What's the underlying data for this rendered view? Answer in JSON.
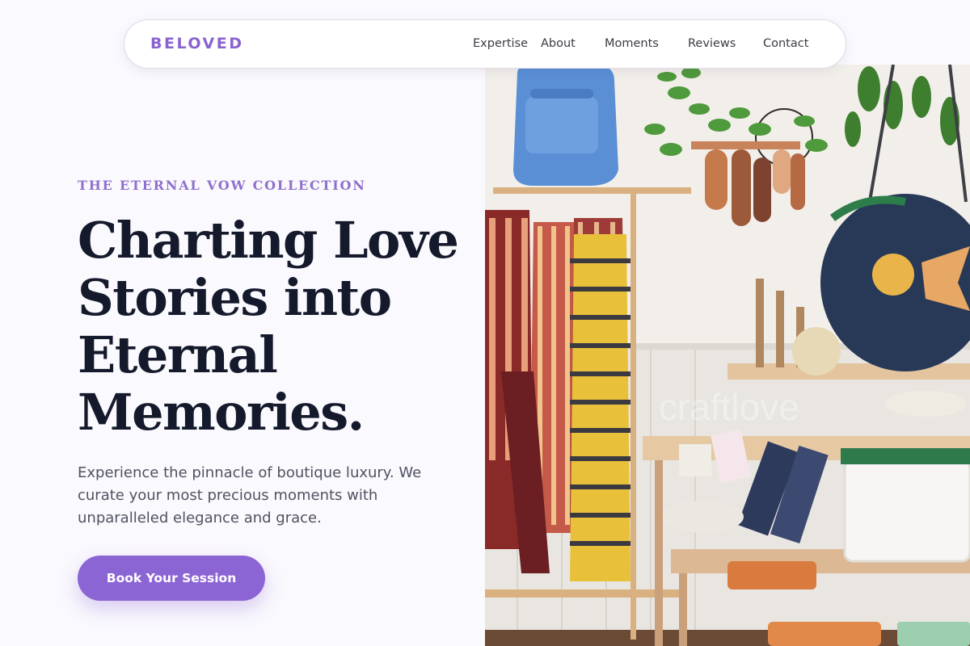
{
  "nav": {
    "brand": "BELOVED",
    "links": [
      "Expertise",
      "About",
      "Moments",
      "Reviews",
      "Contact"
    ]
  },
  "hero": {
    "eyebrow": "THE ETERNAL VOW COLLECTION",
    "headline": "Charting Love Stories into Eternal Memories.",
    "subtitle": "Experience the pinnacle of boutique luxury. We curate your most precious moments with unparalleled elegance and grace.",
    "cta_label": "Book Your Session"
  },
  "photo": {
    "watermark": "craftlove"
  },
  "colors": {
    "accent": "#8c65d4",
    "brand": "#8a63cf",
    "heading": "#141a2c",
    "background": "#faf9fd"
  }
}
